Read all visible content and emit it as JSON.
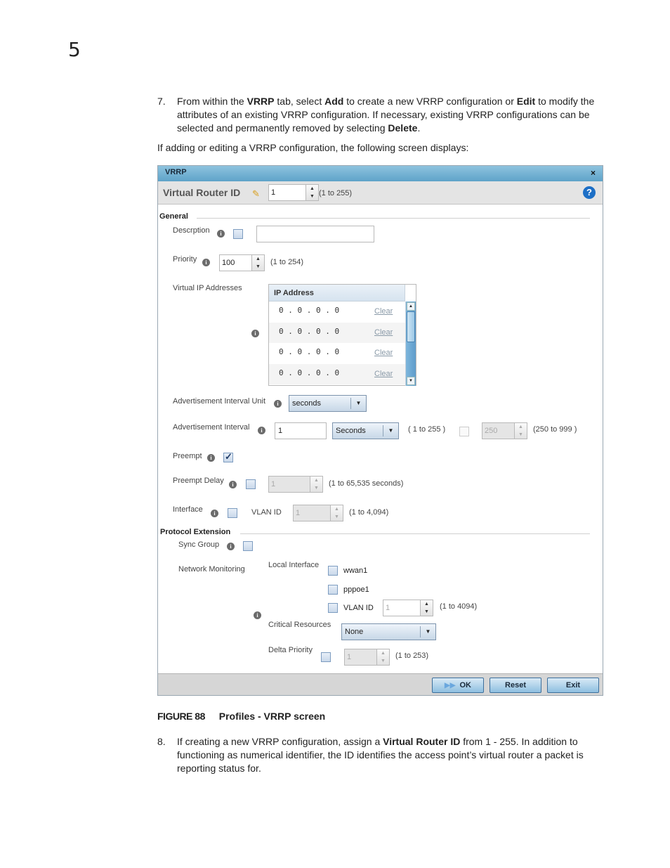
{
  "chapter_number": "5",
  "step7": {
    "num": "7.",
    "text_parts": [
      "From within the ",
      "VRRP",
      " tab, select ",
      "Add",
      " to create a new VRRP configuration or ",
      "Edit",
      " to modify the attributes of an existing VRRP configuration. If necessary, existing VRRP configurations can be selected and permanently removed by selecting ",
      "Delete",
      "."
    ]
  },
  "intro": "If adding or editing a VRRP configuration, the following screen displays:",
  "dialog": {
    "title": "VRRP",
    "close_icon": "×",
    "header": {
      "label": "Virtual Router ID",
      "pencil_icon": "✎",
      "value": "1",
      "range": "(1 to 255)",
      "help_icon": "?"
    },
    "general": {
      "section_title": "General",
      "description_label": "Descrption",
      "description_value": "",
      "priority_label": "Priority",
      "priority_value": "100",
      "priority_range": "(1 to 254)",
      "vip_label": "Virtual IP Addresses",
      "ip_table": {
        "header": "IP Address",
        "rows": [
          {
            "ip": "0 . 0 . 0 . 0",
            "action": "Clear"
          },
          {
            "ip": "0 . 0 . 0 . 0",
            "action": "Clear"
          },
          {
            "ip": "0 . 0 . 0 . 0",
            "action": "Clear"
          },
          {
            "ip": "0 . 0 . 0 . 0",
            "action": "Clear"
          }
        ]
      },
      "adv_unit_label": "Advertisement Interval Unit",
      "adv_unit_value": "seconds",
      "adv_interval_label": "Advertisement Interval",
      "adv_interval_value": "1",
      "adv_interval_unit": "Seconds",
      "adv_interval_range": "( 1 to 255 )",
      "adv_ms_value": "250",
      "adv_ms_range": "(250 to 999 )",
      "preempt_label": "Preempt",
      "preempt_checked": true,
      "preempt_delay_label": "Preempt Delay",
      "preempt_delay_value": "1",
      "preempt_delay_range": "(1 to 65,535 seconds)",
      "interface_label": "Interface",
      "vlan_label": "VLAN ID",
      "vlan_value": "1",
      "vlan_range": "(1 to 4,094)"
    },
    "protocol": {
      "section_title": "Protocol Extension",
      "sync_group_label": "Sync Group",
      "network_monitoring_label": "Network Monitoring",
      "local_interface_label": "Local Interface",
      "interfaces": [
        "wwan1",
        "pppoe1",
        "VLAN ID"
      ],
      "nm_vlan_value": "1",
      "nm_vlan_range": "(1 to 4094)",
      "critical_resources_label": "Critical Resources",
      "critical_resources_value": "None",
      "delta_priority_label": "Delta Priority",
      "delta_priority_value": "1",
      "delta_priority_range": "(1 to 253)"
    },
    "buttons": {
      "ok": "OK",
      "reset": "Reset",
      "exit": "Exit"
    }
  },
  "caption": {
    "figure": "FIGURE 88",
    "title": "Profiles - VRRP screen"
  },
  "step8": {
    "num": "8.",
    "text_parts": [
      "If creating a new VRRP configuration, assign a ",
      "Virtual Router ID",
      " from 1 - 255. In addition to functioning as numerical identifier, the ID identifies the access point’s virtual router a packet is reporting status for."
    ]
  }
}
